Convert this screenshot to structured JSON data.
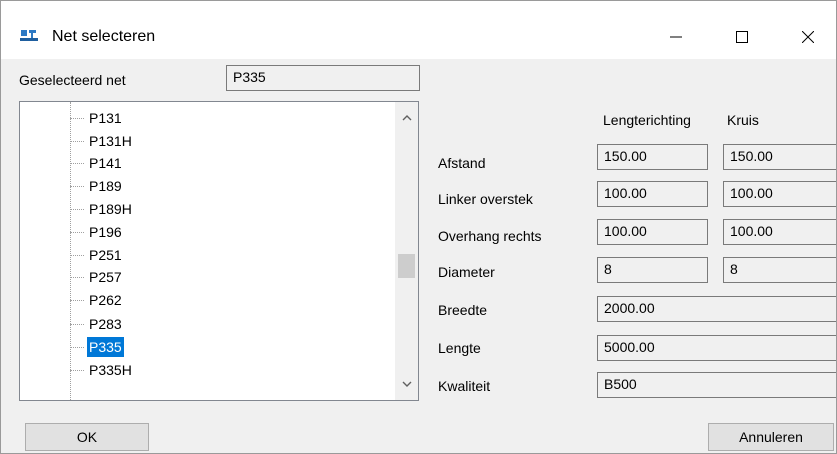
{
  "window": {
    "title": "Net selecteren",
    "icon": "net-app-icon"
  },
  "selected_net": {
    "label": "Geselecteerd net",
    "value": "P335"
  },
  "tree": {
    "items": [
      "P131",
      "P131H",
      "P141",
      "P189",
      "P189H",
      "P196",
      "P251",
      "P257",
      "P262",
      "P283",
      "P335",
      "P335H"
    ],
    "selected": "P335"
  },
  "props": {
    "col_length": "Lengterichting",
    "col_cross": "Kruis",
    "rows": [
      {
        "label": "Afstand",
        "length": "150.00",
        "cross": "150.00"
      },
      {
        "label": "Linker overstek",
        "length": "100.00",
        "cross": "100.00"
      },
      {
        "label": "Overhang rechts",
        "length": "100.00",
        "cross": "100.00"
      },
      {
        "label": "Diameter",
        "length": "8",
        "cross": "8"
      },
      {
        "label": "Breedte",
        "value": "2000.00"
      },
      {
        "label": "Lengte",
        "value": "5000.00"
      },
      {
        "label": "Kwaliteit",
        "value": "B500"
      }
    ]
  },
  "buttons": {
    "ok": "OK",
    "cancel": "Annuleren"
  }
}
